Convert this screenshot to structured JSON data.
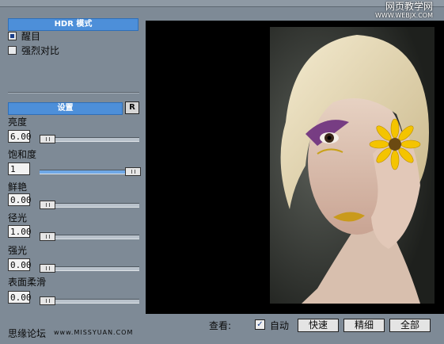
{
  "watermark": {
    "line1": "网页教学网",
    "line2": "WWW.WEBJX.COM"
  },
  "hdr": {
    "section_title": "HDR 模式",
    "options": [
      {
        "label": "醒目",
        "selected": true
      },
      {
        "label": "强烈对比",
        "selected": false
      }
    ]
  },
  "settings": {
    "section_title": "设置",
    "reset_label": "R",
    "params": [
      {
        "label": "亮度",
        "value": "6.00",
        "level": 0.0
      },
      {
        "label": "饱和度",
        "value": "1",
        "level": 1.0
      },
      {
        "label": "鲜艳",
        "value": "0.00",
        "level": 0.0
      },
      {
        "label": "径光",
        "value": "1.00",
        "level": 0.0
      },
      {
        "label": "强光",
        "value": "0.00",
        "level": 0.0
      },
      {
        "label": "表面柔滑",
        "value": "0.00",
        "level": 0.0
      }
    ]
  },
  "footer": {
    "forum": "思缘论坛",
    "url": "www.MISSYUAN.COM",
    "view_label": "查看:",
    "auto_label": "自动",
    "auto_checked": true,
    "buttons": [
      "快速",
      "精细",
      "全部"
    ]
  },
  "colors": {
    "accent": "#4d8fd9",
    "panel": "#7e8a96",
    "preview_bg": "#000000"
  }
}
